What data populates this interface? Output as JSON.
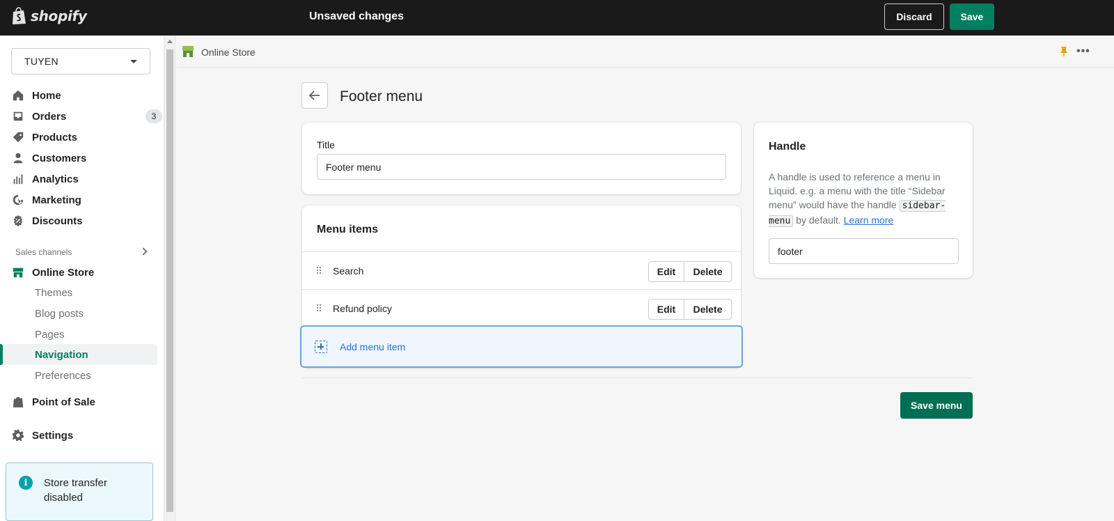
{
  "topbar": {
    "brand": "shopify",
    "status": "Unsaved changes",
    "discard_label": "Discard",
    "save_label": "Save"
  },
  "sidebar": {
    "store_name": "TUYEN",
    "nav": [
      {
        "label": "Home",
        "icon": "home-icon"
      },
      {
        "label": "Orders",
        "icon": "orders-icon",
        "badge": "3"
      },
      {
        "label": "Products",
        "icon": "tag-icon"
      },
      {
        "label": "Customers",
        "icon": "person-icon"
      },
      {
        "label": "Analytics",
        "icon": "analytics-icon"
      },
      {
        "label": "Marketing",
        "icon": "marketing-icon"
      },
      {
        "label": "Discounts",
        "icon": "discount-icon"
      }
    ],
    "sales_channels_label": "Sales channels",
    "online_store": {
      "label": "Online Store",
      "sub": [
        "Themes",
        "Blog posts",
        "Pages",
        "Navigation",
        "Preferences"
      ],
      "active": "Navigation"
    },
    "point_of_sale": "Point of Sale",
    "settings": "Settings",
    "notice": "Store transfer disabled"
  },
  "breadcrumb": {
    "label": "Online Store"
  },
  "page": {
    "title": "Footer menu",
    "title_field": {
      "label": "Title",
      "value": "Footer menu"
    },
    "menu_items": {
      "heading": "Menu items",
      "items": [
        {
          "label": "Search"
        },
        {
          "label": "Refund policy"
        }
      ],
      "edit_label": "Edit",
      "delete_label": "Delete",
      "add_label": "Add menu item"
    },
    "handle": {
      "heading": "Handle",
      "desc_pre": "A handle is used to reference a menu in Liquid. e.g. a menu with the title “Sidebar menu” would have the handle",
      "code": "sidebar-menu",
      "desc_post": "by default.",
      "learn_more": "Learn more",
      "value": "footer"
    },
    "save_menu_label": "Save menu"
  },
  "colors": {
    "primary": "#008060",
    "topbar": "#1a1a1a",
    "link": "#2c6ecb"
  }
}
